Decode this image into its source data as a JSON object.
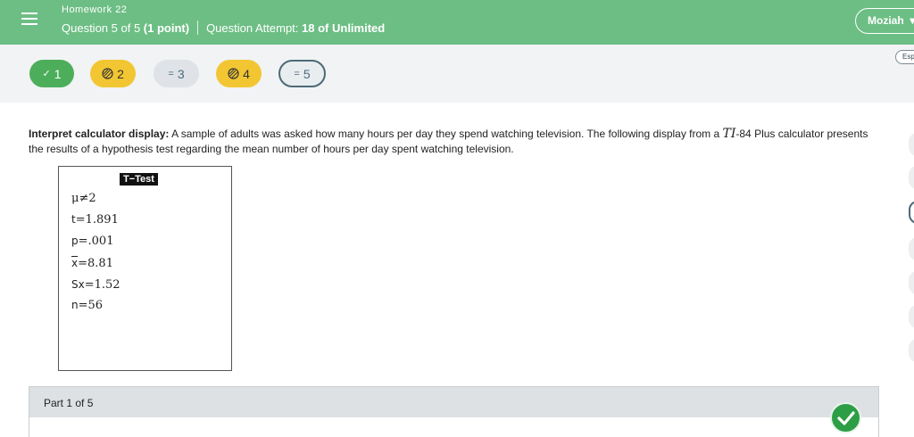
{
  "header": {
    "homework_title": "Homework 22",
    "question_label": "Question 5 of 5",
    "question_points": "(1 point)",
    "attempt_label": "Question Attempt:",
    "attempt_value": "18 of Unlimited",
    "user_name": "Moziah"
  },
  "nav": {
    "language_button": "Esp",
    "pills": [
      {
        "number": "1",
        "status": "correct",
        "icon": "check-icon",
        "color": "#4cae5a"
      },
      {
        "number": "2",
        "status": "partial",
        "icon": "hatched-circle-icon",
        "color": "#f2c632"
      },
      {
        "number": "3",
        "status": "unanswered",
        "icon": "lines-icon",
        "color": "#dfe3e7"
      },
      {
        "number": "4",
        "status": "partial",
        "icon": "hatched-circle-icon",
        "color": "#f2c632"
      },
      {
        "number": "5",
        "status": "current",
        "icon": "lines-icon",
        "color": "#e8edf0"
      }
    ]
  },
  "question": {
    "lead": "Interpret calculator display:",
    "text_1": " A sample of adults was asked how many hours per day they spend watching television. The following display from a ",
    "calc_model": "TI",
    "text_2": "-84 Plus calculator presents the results of a hypothesis test regarding the mean number of hours per day spent watching television."
  },
  "calculator": {
    "title": "T−Test",
    "lines": [
      {
        "label": "μ",
        "op": "≠",
        "value": "2"
      },
      {
        "label": "t",
        "op": "=",
        "value": "1.891"
      },
      {
        "label": "p",
        "op": "=",
        "value": ".001"
      },
      {
        "label": "x",
        "op": "=",
        "value": "8.81"
      },
      {
        "label": "Sx",
        "op": "=",
        "value": "1.52"
      },
      {
        "label": "n",
        "op": "=",
        "value": "56"
      }
    ]
  },
  "part": {
    "label": "Part 1 of 5",
    "status_icon": "checkmark-circle-icon",
    "status_color": "#2e9e46"
  }
}
